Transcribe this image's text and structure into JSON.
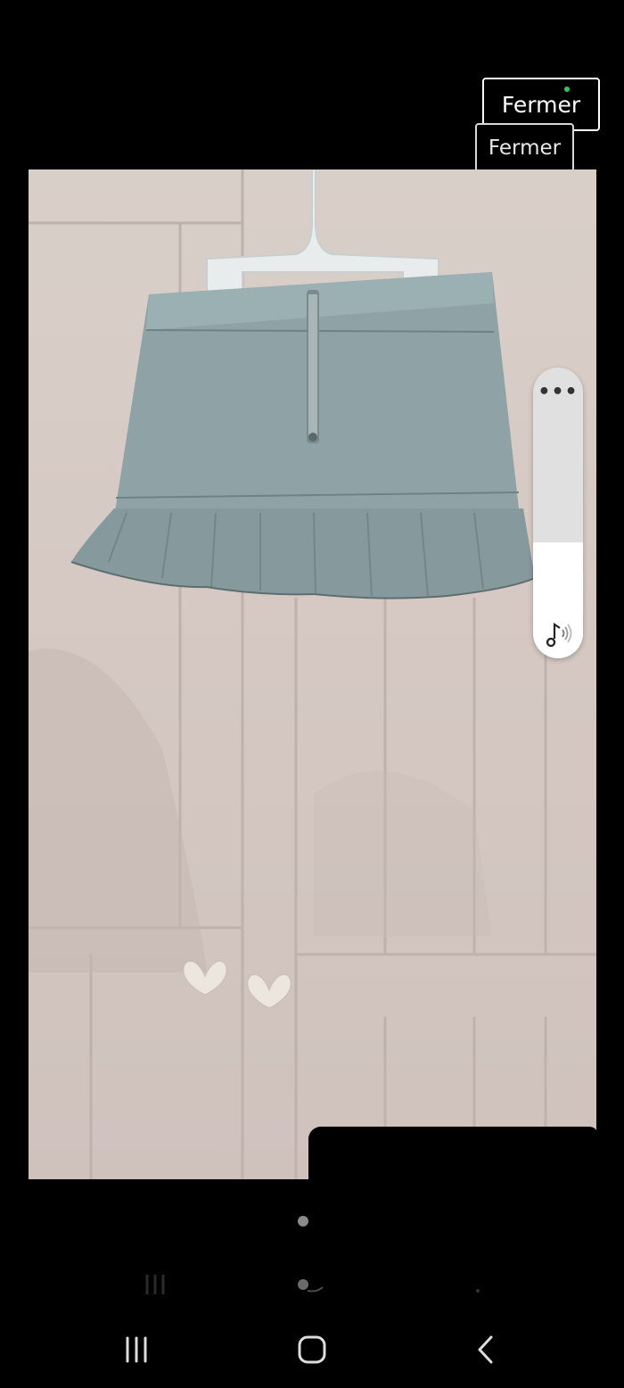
{
  "close_buttons": {
    "primary_label": "Fermer",
    "secondary_label": "Fermer"
  },
  "photo": {
    "subject": "skirt-photo"
  },
  "volume_panel": {
    "more_label": "•••",
    "level_fraction": 0.4,
    "icon": "music-note-volume-icon"
  },
  "pager": {
    "current_page": 1
  },
  "navigation_bar": {
    "recents_icon": "recents-icon",
    "home_icon": "home-icon",
    "back_icon": "back-icon"
  },
  "colors": {
    "background": "#000000",
    "accent_dot": "#34c759",
    "denim": "#8fa3a6"
  }
}
